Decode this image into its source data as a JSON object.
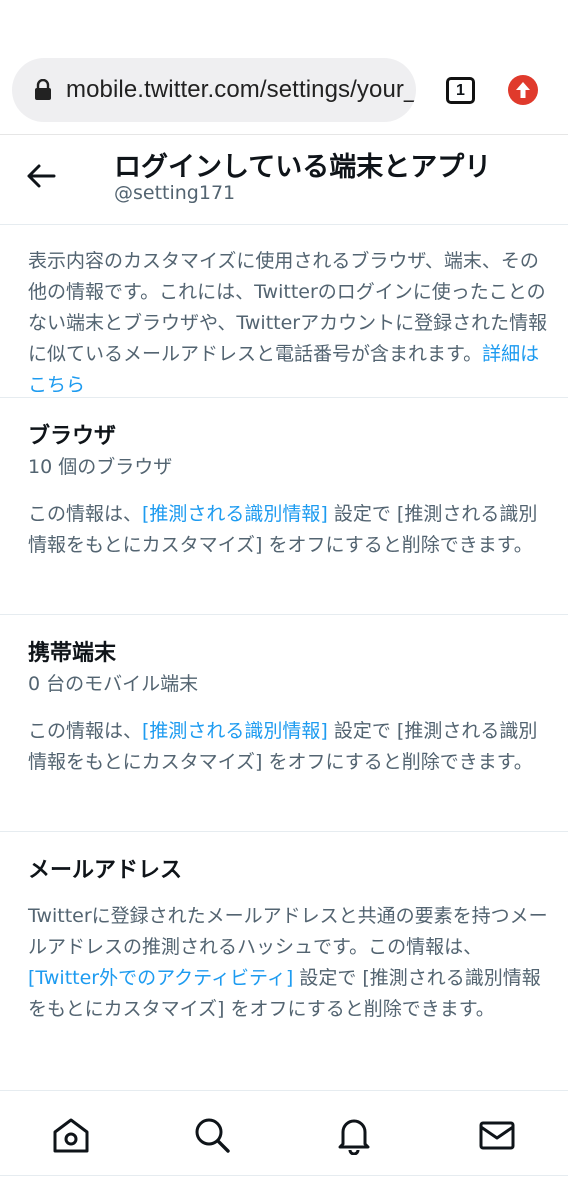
{
  "browser": {
    "url": "mobile.twitter.com/settings/your_twitter_data",
    "tab_count": "1"
  },
  "header": {
    "title": "ログインしている端末とアプリ",
    "username": "@setting171"
  },
  "intro": {
    "text": "表示内容のカスタマイズに使用されるブラウザ、端末、その他の情報です。これには、Twitterのログインに使ったことのない端末とブラウザや、Twitterアカウントに登録された情報に似ているメールアドレスと電話番号が含まれます。",
    "link": "詳細はこちら"
  },
  "sections": [
    {
      "title": "ブラウザ",
      "count": "10 個のブラウザ",
      "text_before": "この情報は、",
      "link": "[推測される識別情報]",
      "text_after": " 設定で [推測される識別情報をもとにカスタマイズ] をオフにすると削除できます。"
    },
    {
      "title": "携帯端末",
      "count": "0 台のモバイル端末",
      "text_before": "この情報は、",
      "link": "[推測される識別情報]",
      "text_after": " 設定で [推測される識別情報をもとにカスタマイズ] をオフにすると削除できます。"
    },
    {
      "title": "メールアドレス",
      "text_before": "Twitterに登録されたメールアドレスと共通の要素を持つメールアドレスの推測されるハッシュです。この情報は、",
      "link": "[Twitter外でのアクティビティ]",
      "text_after": " 設定で [推測される識別情報をもとにカスタマイズ] をオフにすると削除できます。"
    }
  ],
  "nav": {
    "icons": [
      "home-icon",
      "search-icon",
      "bell-icon",
      "mail-icon"
    ]
  },
  "colors": {
    "accent": "#1d9bf0",
    "secondary_text": "#536471",
    "update_badge": "#e03a2c"
  }
}
